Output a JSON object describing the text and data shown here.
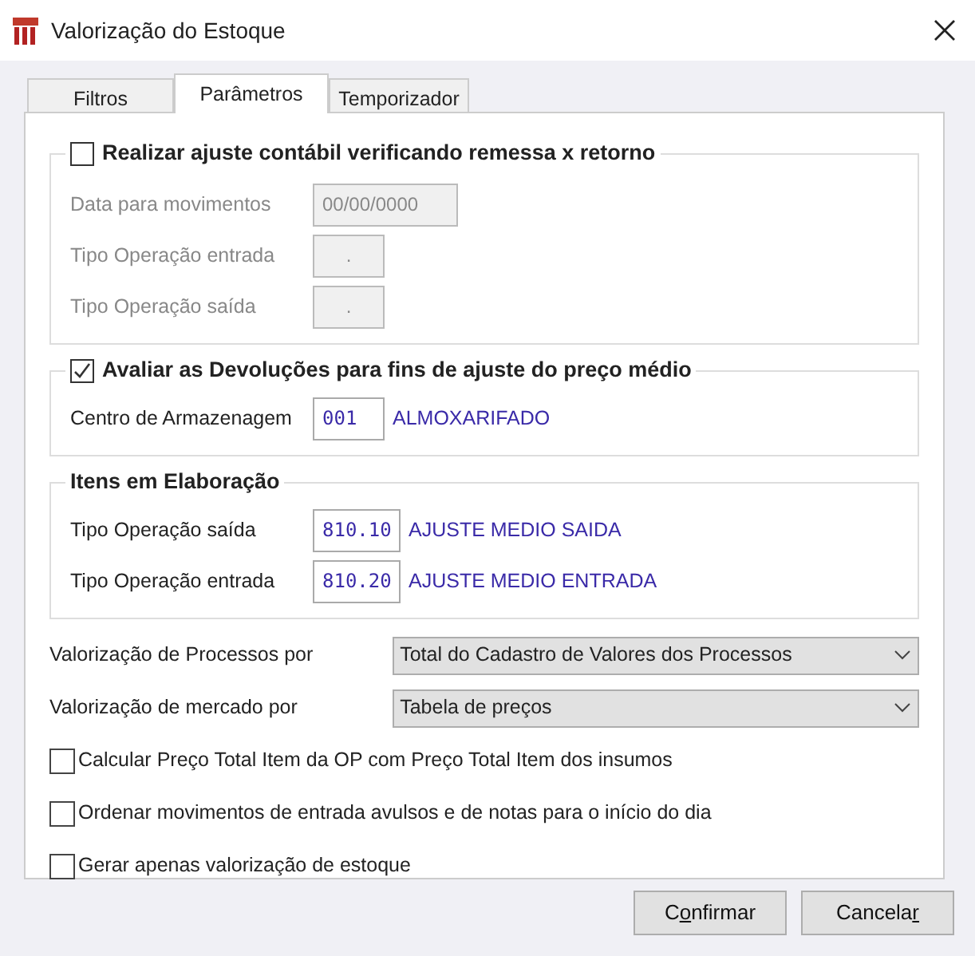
{
  "window": {
    "title": "Valorização do Estoque"
  },
  "tabs": [
    {
      "label": "Filtros",
      "selected": false
    },
    {
      "label": "Parâmetros",
      "selected": true
    },
    {
      "label": "Temporizador",
      "selected": false
    }
  ],
  "groups": [
    {
      "title": "Realizar ajuste contábil verificando remessa x retorno",
      "kind": "checkbox",
      "checked": false,
      "fields": [
        {
          "label": "Data para movimentos",
          "kind": "date",
          "value": "00/00/0000",
          "disabled": true
        },
        {
          "label": "Tipo Operação entrada",
          "kind": "code",
          "value": ".",
          "disabled": true
        },
        {
          "label": "Tipo Operação saída",
          "kind": "code",
          "value": ".",
          "disabled": true
        }
      ]
    },
    {
      "title": "Avaliar as Devoluções para fins de ajuste do preço médio",
      "kind": "checkbox",
      "checked": true,
      "fields": [
        {
          "label": "Centro de Armazenagem",
          "kind": "code",
          "value": "001",
          "disabled": false,
          "description": "ALMOXARIFADO"
        }
      ]
    },
    {
      "title": "Itens em Elaboração",
      "kind": "plain",
      "fields": [
        {
          "label": "Tipo Operação saída",
          "kind": "code",
          "value": "810.10",
          "disabled": false,
          "description": "AJUSTE MEDIO SAIDA"
        },
        {
          "label": "Tipo Operação entrada",
          "kind": "code",
          "value": "810.20",
          "disabled": false,
          "description": "AJUSTE MEDIO ENTRADA"
        }
      ]
    }
  ],
  "selects": [
    {
      "label": "Valorização de Processos por",
      "value": "Total do Cadastro de Valores dos Processos"
    },
    {
      "label": "Valorização de mercado por",
      "value": "Tabela de preços"
    }
  ],
  "options": [
    {
      "label": "Calcular Preço Total Item da OP com Preço Total Item dos insumos",
      "checked": false
    },
    {
      "label": "Ordenar movimentos de entrada avulsos e de notas para o início do dia",
      "checked": false
    },
    {
      "label": "Gerar apenas valorização de estoque",
      "checked": false
    }
  ],
  "buttons": [
    {
      "label_before": "C",
      "access_key": "o",
      "label_after": "nfirmar"
    },
    {
      "label_before": "Cancela",
      "access_key": "r"
    }
  ]
}
